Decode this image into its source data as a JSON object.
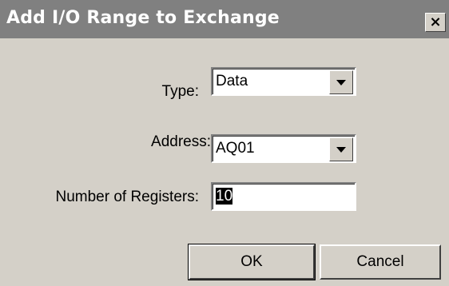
{
  "window": {
    "title": "Add I/O Range to Exchange",
    "close_glyph": "×",
    "close_icon": "close-icon"
  },
  "form": {
    "type_label": "Type:",
    "type_value": "Data",
    "address_label": "Address:",
    "address_value": "AQ01",
    "registers_label": "Number of Registers:",
    "registers_value": "10"
  },
  "buttons": {
    "ok_label": "OK",
    "cancel_label": "Cancel"
  },
  "colors": {
    "titlebar": "#808080",
    "dialog_face": "#d4d0c8",
    "selection": "#000000"
  }
}
